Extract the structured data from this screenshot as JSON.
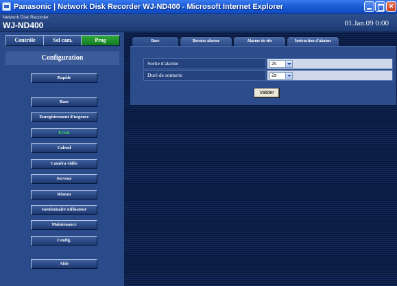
{
  "window": {
    "title": "Panasonic | Network Disk Recorder WJ-ND400 - Microsoft Internet Explorer"
  },
  "header": {
    "subtitle": "Network Disk Recorder",
    "model": "WJ-ND400",
    "datetime": "01.Jan.09  0:00"
  },
  "modes": [
    {
      "label": "Contrôle",
      "active": false
    },
    {
      "label": "Sel cam.",
      "active": false
    },
    {
      "label": "Prog",
      "active": true
    }
  ],
  "sidebar": {
    "title": "Configuration",
    "items": [
      {
        "label": "Rapide"
      },
      {
        "label": "Base"
      },
      {
        "label": "Enregistrement d'urgence"
      },
      {
        "label": "Event",
        "selected": true
      },
      {
        "label": "Calend"
      },
      {
        "label": "Caméra vidéo"
      },
      {
        "label": "Serveur"
      },
      {
        "label": "Réseau"
      },
      {
        "label": "Gestionnaire utilisateur"
      },
      {
        "label": "Maintenance"
      },
      {
        "label": "Config."
      },
      {
        "label": "Aide"
      }
    ]
  },
  "tabs": [
    {
      "label": "Base",
      "active": true
    },
    {
      "label": "Bornier alarme"
    },
    {
      "label": "Alarme de site"
    },
    {
      "label": "Instruction d'alarme"
    }
  ],
  "form": {
    "rows": [
      {
        "label": "Sortie d'alarme",
        "value": "2s"
      },
      {
        "label": "Duré de sonnerie",
        "value": "2s"
      }
    ],
    "submit_label": "Valider"
  },
  "colors": {
    "active_mode": "#1e8f2c",
    "selected_menu_text": "#39e35a",
    "panel": "#2c4c8c"
  }
}
